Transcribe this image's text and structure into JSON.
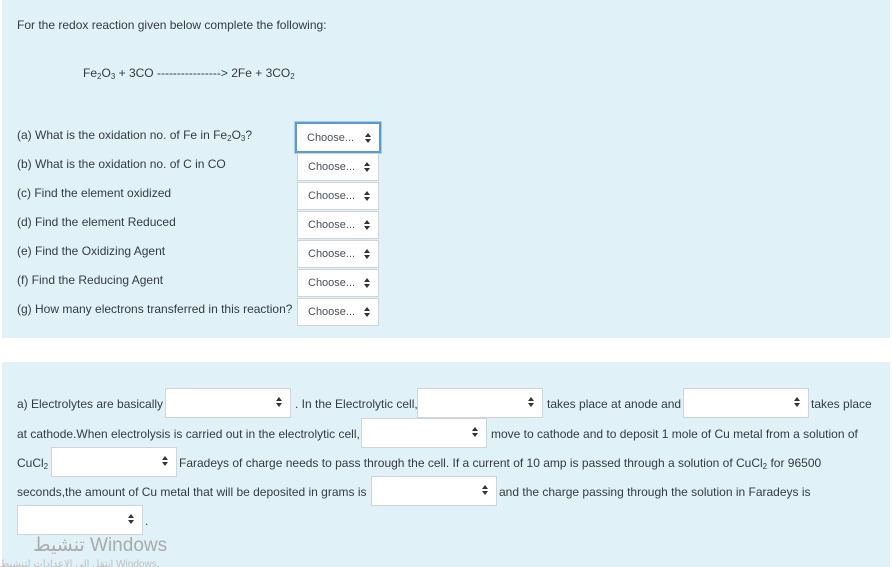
{
  "q1": {
    "intro": "For the redox reaction given below complete the following:",
    "equation": {
      "lhs_fe": "Fe",
      "lhs_sub1": "2",
      "lhs_o": "O",
      "lhs_sub2": "3",
      "lhs_rest": " + 3CO ----------------> 2Fe + 3CO",
      "rhs_sub": "2"
    },
    "questions": [
      {
        "text": "(a) What is the oxidation no. of Fe in Fe",
        "sub1": "2",
        "mid": "O",
        "sub2": "3",
        "end": "?",
        "select": "Choose..."
      },
      {
        "text": "(b) What is the oxidation no. of C in CO",
        "select": "Choose..."
      },
      {
        "text": "(c) Find the element oxidized",
        "select": "Choose..."
      },
      {
        "text": "(d) Find the element Reduced",
        "select": "Choose..."
      },
      {
        "text": "(e) Find the Oxidizing Agent",
        "select": "Choose..."
      },
      {
        "text": "(f)  Find the Reducing Agent",
        "select": "Choose..."
      },
      {
        "text": "(g) How many electrons transferred in this reaction?",
        "select": "Choose..."
      }
    ]
  },
  "q2": {
    "t1": "a) Electrolytes are basically",
    "t2": ". In the Electrolytic cell,",
    "t3": "takes place at anode and",
    "t4": "takes place",
    "t5": "at cathode.When electrolysis is carried out in the electrolytic cell,",
    "t6": "move to cathode and to deposit 1 mole of Cu metal from a solution of",
    "t7": "CuCl",
    "t7sub": "2",
    "t8": "Faradeys of charge needs to pass through the cell. If a current of 10 amp is passed through a solution of CuCl",
    "t8sub": "2",
    "t8end": " for 96500",
    "t9": "seconds,the amount of Cu metal that will be deposited in grams is",
    "t10": "and the charge passing through the solution in Faradeys is",
    "t11": "."
  },
  "watermark": "تنشيط Windows",
  "watermark2": "انتقل إلى الإعدادات لتنشيط Windows."
}
